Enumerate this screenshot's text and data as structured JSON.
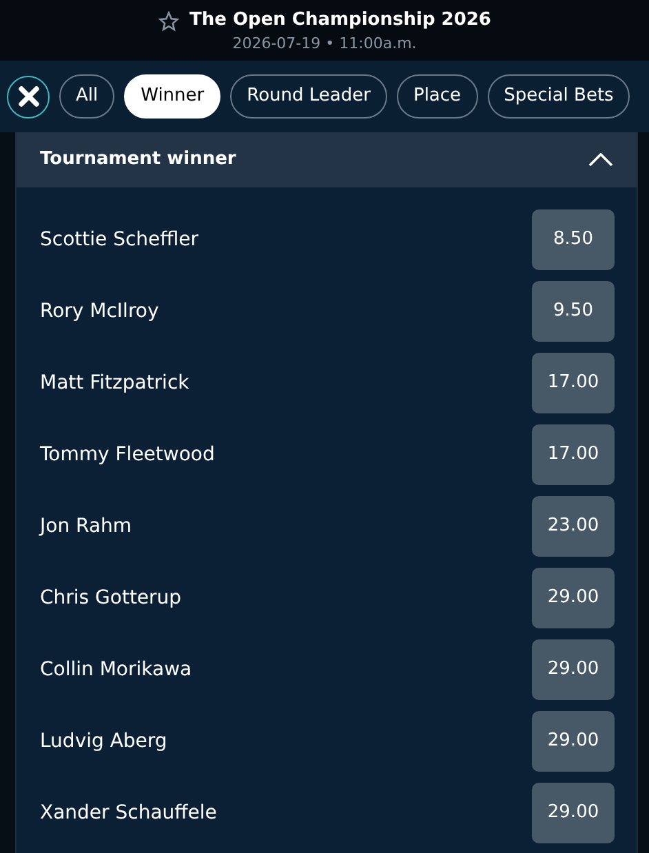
{
  "event": {
    "title": "The Open Championship 2026",
    "datetime": "2026-07-19 • 11:00a.m.",
    "favorite": false
  },
  "filters": [
    {
      "label": "All",
      "selected": false
    },
    {
      "label": "Winner",
      "selected": true
    },
    {
      "label": "Round Leader",
      "selected": false
    },
    {
      "label": "Place",
      "selected": false
    },
    {
      "label": "Special Bets",
      "selected": false
    }
  ],
  "market": {
    "title": "Tournament winner",
    "expanded": true,
    "selections": [
      {
        "name": "Scottie Scheffler",
        "odds": "8.50"
      },
      {
        "name": "Rory McIlroy",
        "odds": "9.50"
      },
      {
        "name": "Matt Fitzpatrick",
        "odds": "17.00"
      },
      {
        "name": "Tommy Fleetwood",
        "odds": "17.00"
      },
      {
        "name": "Jon Rahm",
        "odds": "23.00"
      },
      {
        "name": "Chris Gotterup",
        "odds": "29.00"
      },
      {
        "name": "Collin Morikawa",
        "odds": "29.00"
      },
      {
        "name": "Ludvig Aberg",
        "odds": "29.00"
      },
      {
        "name": "Xander Schauffele",
        "odds": "29.00"
      }
    ]
  }
}
